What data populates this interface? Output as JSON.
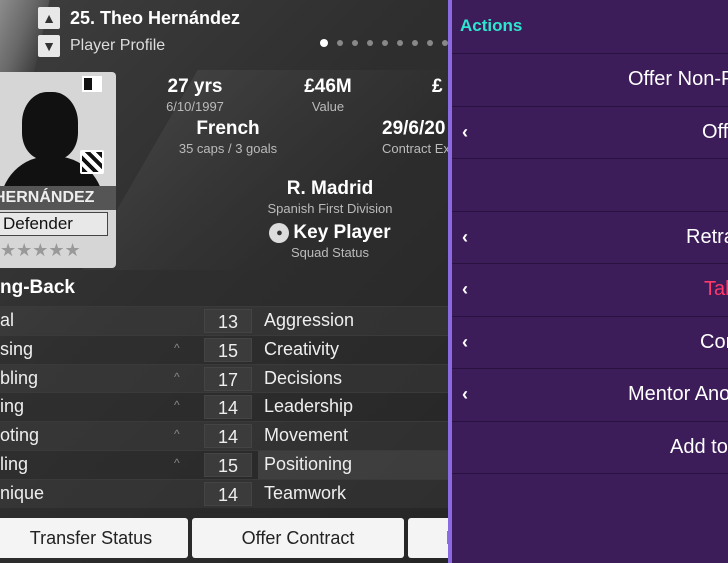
{
  "header": {
    "player_name": "25. Theo Hernández",
    "profile_label": "Player Profile",
    "page_dots": 10,
    "active_dot": 0
  },
  "card": {
    "surname": "HERNÁNDEZ",
    "position": "Defender",
    "stars": "★★★★★"
  },
  "info": {
    "age": "27 yrs",
    "dob": "6/10/1997",
    "value": "£46M",
    "value_label": "Value",
    "wage_partial": "£",
    "nationality": "French",
    "caps": "35 caps / 3 goals",
    "contract_expiry": "29/6/20",
    "contract_label": "Contract Ex",
    "club": "R. Madrid",
    "division": "Spanish First Division",
    "squad_status": "Key Player",
    "squad_status_label": "Squad Status"
  },
  "attributes": {
    "section_title": "ng-Back",
    "rows": [
      {
        "left": "al",
        "caret": "",
        "value": "13",
        "right": "Aggression"
      },
      {
        "left": "sing",
        "caret": "^",
        "value": "15",
        "right": "Creativity"
      },
      {
        "left": "bling",
        "caret": "^",
        "value": "17",
        "right": "Decisions"
      },
      {
        "left": "ing",
        "caret": "^",
        "value": "14",
        "right": "Leadership"
      },
      {
        "left": "oting",
        "caret": "^",
        "value": "14",
        "right": "Movement"
      },
      {
        "left": "ling",
        "caret": "^",
        "value": "15",
        "right": "Positioning"
      },
      {
        "left": "nique",
        "caret": "",
        "value": "14",
        "right": "Teamwork"
      }
    ]
  },
  "buttons": {
    "transfer_status": "Transfer Status",
    "offer_contract": "Offer Contract",
    "third_partial": "M"
  },
  "panel": {
    "title": "Actions",
    "items": [
      {
        "label": "Offer Non-P",
        "submenu": false,
        "color": "white"
      },
      {
        "label": "Off",
        "submenu": true,
        "color": "white"
      },
      {
        "label": "",
        "submenu": false,
        "color": "white"
      },
      {
        "label": "Retra",
        "submenu": true,
        "color": "white"
      },
      {
        "label": "Tal",
        "submenu": true,
        "color": "red"
      },
      {
        "label": "Con",
        "submenu": true,
        "color": "white"
      },
      {
        "label": "Mentor Anot",
        "submenu": true,
        "color": "white"
      },
      {
        "label": "Add to",
        "submenu": false,
        "color": "white"
      }
    ],
    "caret_glyph": "‹"
  },
  "colors": {
    "panel_bg": "#3d1c5a",
    "panel_accent": "#8a6ae0",
    "title_color": "#2ee6cf",
    "alert_color": "#ff3a6b"
  }
}
